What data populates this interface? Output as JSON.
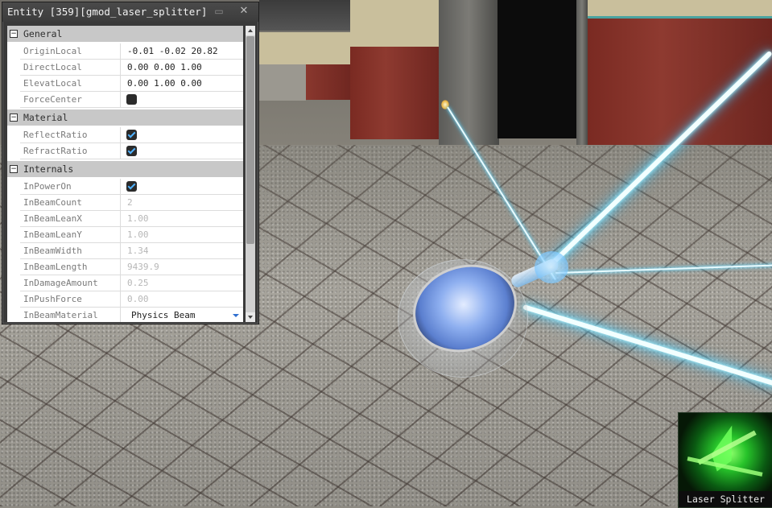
{
  "window": {
    "title": "Entity [359][gmod_laser_splitter]",
    "min_icon": "minimize-icon",
    "close_icon": "close-icon"
  },
  "categories": {
    "general": "General",
    "material": "Material",
    "internals": "Internals"
  },
  "properties": {
    "origin_local": {
      "name": "OriginLocal",
      "value": "-0.01 -0.02 20.82"
    },
    "direct_local": {
      "name": "DirectLocal",
      "value": "0.00 0.00 1.00"
    },
    "elevat_local": {
      "name": "ElevatLocal",
      "value": "0.00 1.00 0.00"
    },
    "force_center": {
      "name": "ForceCenter",
      "checked": false
    },
    "reflect_ratio": {
      "name": "ReflectRatio",
      "checked": true
    },
    "refract_ratio": {
      "name": "RefractRatio",
      "checked": true
    },
    "in_power_on": {
      "name": "InPowerOn",
      "checked": true
    },
    "in_beam_count": {
      "name": "InBeamCount",
      "value": "2"
    },
    "in_beam_lean_x": {
      "name": "InBeamLeanX",
      "value": "1.00"
    },
    "in_beam_lean_y": {
      "name": "InBeamLeanY",
      "value": "1.00"
    },
    "in_beam_width": {
      "name": "InBeamWidth",
      "value": "1.34"
    },
    "in_beam_length": {
      "name": "InBeamLength",
      "value": "9439.9"
    },
    "in_damage_amount": {
      "name": "InDamageAmount",
      "value": "0.25"
    },
    "in_push_force": {
      "name": "InPushForce",
      "value": "0.00"
    },
    "in_beam_material": {
      "name": "InBeamMaterial",
      "value": "Physics Beam"
    }
  },
  "tool": {
    "label": "Laser Splitter",
    "icon": "laser-splitter-crystal-icon"
  },
  "colors": {
    "beam_core": "#f2ffff",
    "beam_glow": "#2ab6ff",
    "checkbox_tick": "#4fb2ff",
    "category_bg": "#c8c8c8"
  }
}
